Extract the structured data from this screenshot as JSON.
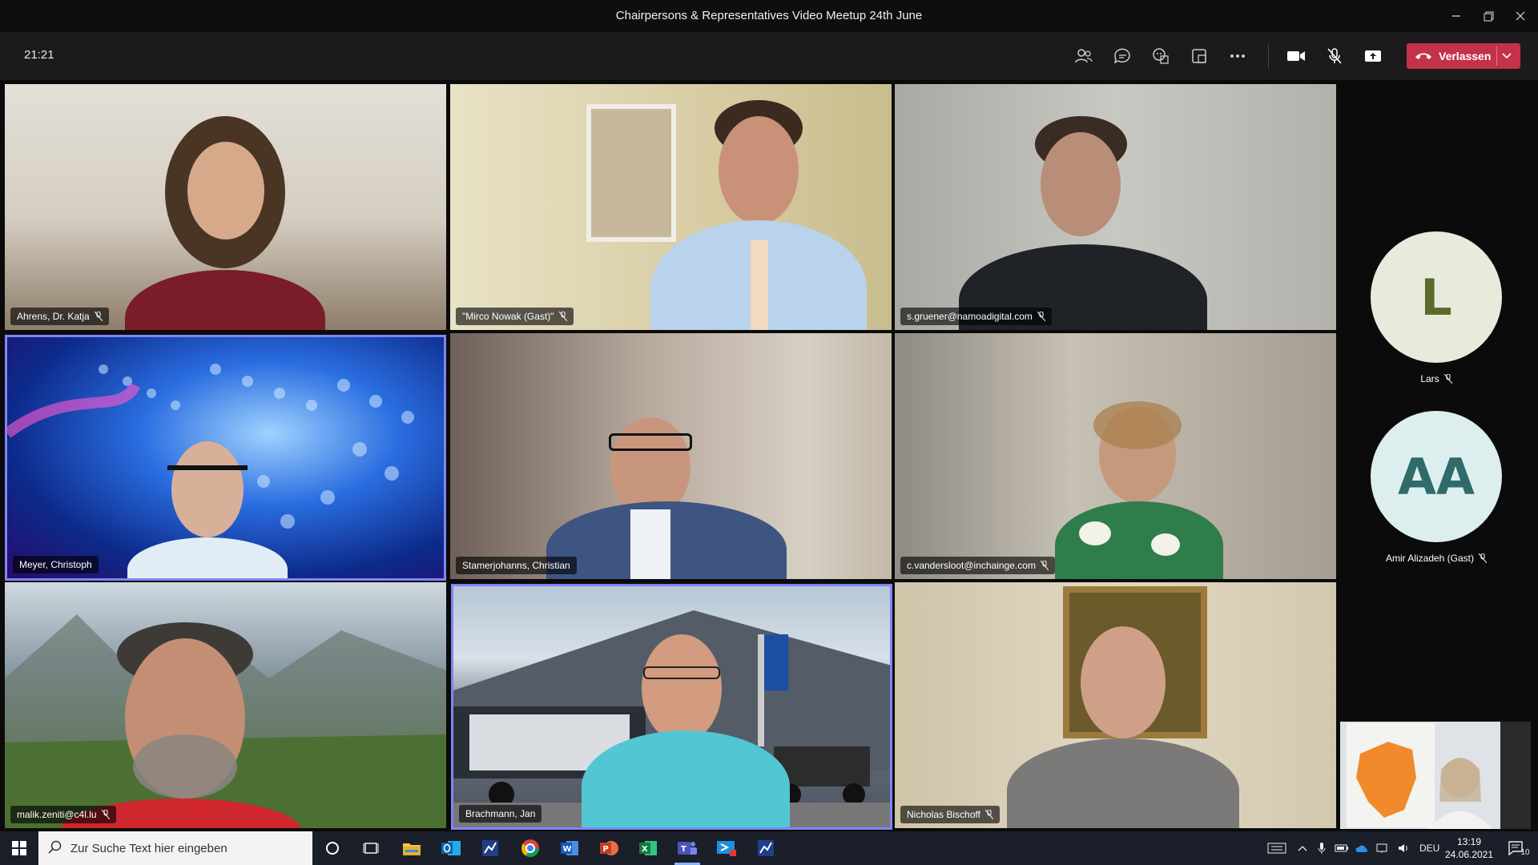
{
  "window": {
    "title": "Chairpersons & Representatives Video Meetup 24th June"
  },
  "toolbar": {
    "time": "21:21",
    "leave_label": "Verlassen",
    "icons": [
      "participants-icon",
      "chat-icon",
      "reactions-icon",
      "rooms-icon",
      "more-options-icon",
      "camera-icon",
      "mic-muted-icon",
      "share-screen-icon"
    ]
  },
  "participants": [
    {
      "name": "Ahrens, Dr. Katja",
      "muted": true
    },
    {
      "name": "\"Mirco Nowak (Gast)\"",
      "muted": true
    },
    {
      "name": "s.gruener@namoadigital.com",
      "muted": true
    },
    {
      "name": "Meyer, Christoph",
      "muted": false
    },
    {
      "name": "Stamerjohanns, Christian",
      "muted": false
    },
    {
      "name": "c.vandersloot@inchainge.com",
      "muted": true
    },
    {
      "name": "malik.zeniti@c4l.lu",
      "muted": true
    },
    {
      "name": "Brachmann, Jan",
      "muted": false
    },
    {
      "name": "Nicholas Bischoff",
      "muted": true
    }
  ],
  "avatars": [
    {
      "initials": "L",
      "name": "Lars",
      "muted": true,
      "bg": "#e8ebdc",
      "fg": "#5a6b2e"
    },
    {
      "initials": "AA",
      "name": "Amir Alizadeh (Gast)",
      "muted": true,
      "bg": "#dcefee",
      "fg": "#2f6b6b"
    }
  ],
  "taskbar": {
    "search_placeholder": "Zur Suche Text hier eingeben",
    "language": "DEU",
    "time": "13:19",
    "date": "24.06.2021",
    "notification_count": "10",
    "apps": [
      "cortana-icon",
      "task-view-icon",
      "file-explorer-icon",
      "outlook-icon",
      "chart-app-icon",
      "chrome-icon",
      "word-icon",
      "powerpoint-icon",
      "excel-icon",
      "teams-icon",
      "remote-desktop-icon",
      "chart-app-icon"
    ]
  },
  "colors": {
    "accent": "#7f85f5",
    "leave": "#c4314b",
    "toolbar_bg": "#1b1b1b",
    "taskbar_bg": "#1a1f29"
  }
}
